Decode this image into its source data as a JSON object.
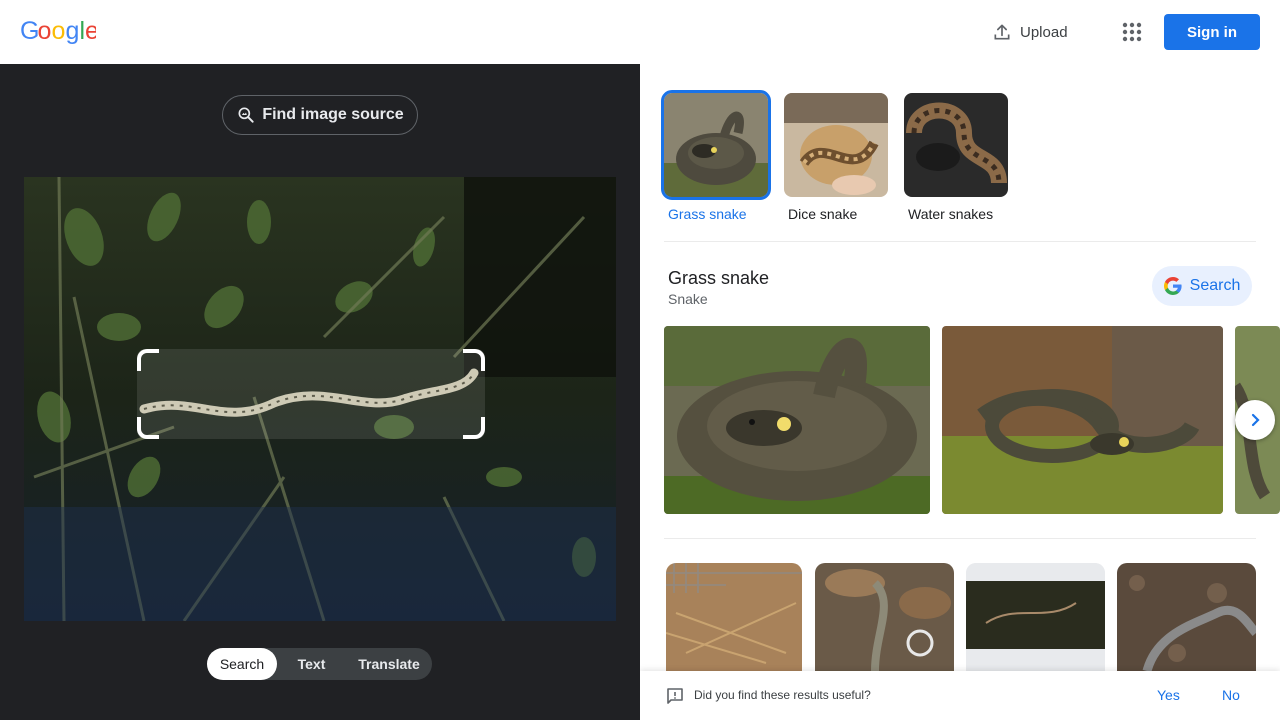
{
  "header": {
    "logo_text": "Google",
    "upload_label": "Upload",
    "sign_in_label": "Sign in"
  },
  "left": {
    "find_source_label": "Find image source",
    "modes": [
      {
        "label": "Search",
        "active": true
      },
      {
        "label": "Text",
        "active": false
      },
      {
        "label": "Translate",
        "active": false
      }
    ]
  },
  "related": [
    {
      "label": "Grass snake",
      "selected": true
    },
    {
      "label": "Dice snake",
      "selected": false
    },
    {
      "label": "Water snakes",
      "selected": false
    }
  ],
  "knowledge": {
    "title": "Grass snake",
    "subtitle": "Snake",
    "search_label": "Search"
  },
  "feedback": {
    "question": "Did you find these results useful?",
    "yes_label": "Yes",
    "no_label": "No"
  },
  "colors": {
    "accent": "#1a73e8",
    "dark_panel": "#202124"
  }
}
